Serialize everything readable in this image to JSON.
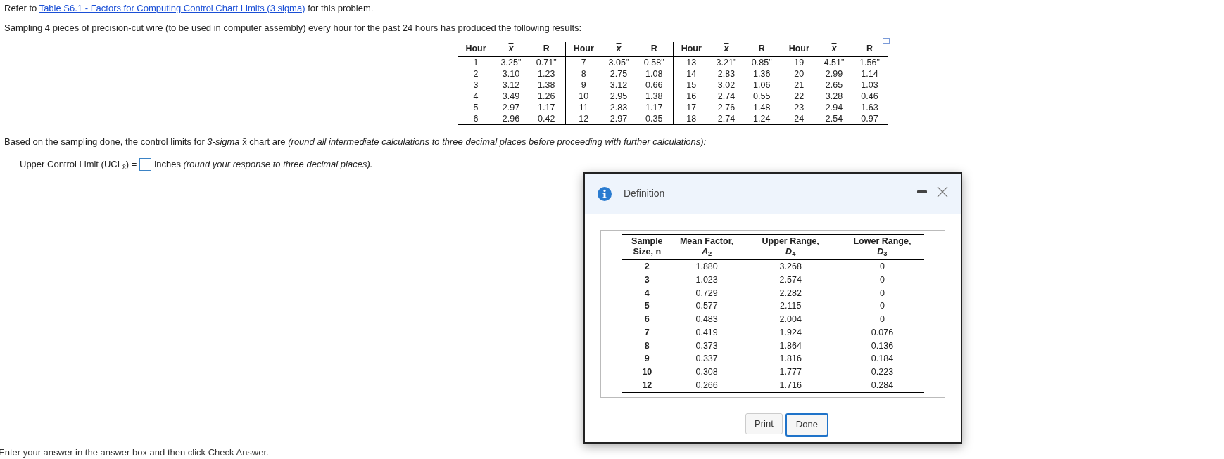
{
  "reference": {
    "prefix": "Refer to",
    "link": "Table S6.1 - Factors for Computing Control Chart Limits (3 sigma)",
    "suffix": "for this problem."
  },
  "intro": "Sampling 4 pieces of precision-cut wire (to be used in computer assembly) every hour for the past 24 hours has produced the following results:",
  "data_table": {
    "columns": [
      "Hour",
      "x",
      "R",
      "Hour",
      "x",
      "R",
      "Hour",
      "x",
      "R",
      "Hour",
      "x",
      "R"
    ],
    "rows": [
      [
        "1",
        "3.25\"",
        "0.71\"",
        "7",
        "3.05\"",
        "0.58\"",
        "13",
        "3.21\"",
        "0.85\"",
        "19",
        "4.51\"",
        "1.56\""
      ],
      [
        "2",
        "3.10",
        "1.23",
        "8",
        "2.75",
        "1.08",
        "14",
        "2.83",
        "1.36",
        "20",
        "2.99",
        "1.14"
      ],
      [
        "3",
        "3.12",
        "1.38",
        "9",
        "3.12",
        "0.66",
        "15",
        "3.02",
        "1.06",
        "21",
        "2.65",
        "1.03"
      ],
      [
        "4",
        "3.49",
        "1.26",
        "10",
        "2.95",
        "1.38",
        "16",
        "2.74",
        "0.55",
        "22",
        "3.28",
        "0.46"
      ],
      [
        "5",
        "2.97",
        "1.17",
        "11",
        "2.83",
        "1.17",
        "17",
        "2.76",
        "1.48",
        "23",
        "2.94",
        "1.63"
      ],
      [
        "6",
        "2.96",
        "0.42",
        "12",
        "2.97",
        "0.35",
        "18",
        "2.74",
        "1.24",
        "24",
        "2.54",
        "0.97"
      ]
    ]
  },
  "question": "Based on the sampling done, the control limits for *3-sigma* x̄ chart are *(round all intermediate calculations to three decimal places before proceeding with further calculations):*",
  "answer": {
    "label": "Upper Control Limit (UCL$_{x̄}$) =",
    "suffix": "inches *(round your response to three decimal places).*"
  },
  "footer": "Enter your answer in the answer box and then click Check Answer.",
  "dialog": {
    "title": "Definition",
    "columns": [
      {
        "line1": "Sample",
        "line2": "Size, n"
      },
      {
        "line1": "Mean Factor,",
        "line2": "*A*$_{2}$"
      },
      {
        "line1": "Upper Range,",
        "line2": "*D*$_{4}$"
      },
      {
        "line1": "Lower Range,",
        "line2": "*D*$_{3}$"
      }
    ],
    "rows": [
      [
        "2",
        "1.880",
        "3.268",
        "0"
      ],
      [
        "3",
        "1.023",
        "2.574",
        "0"
      ],
      [
        "4",
        "0.729",
        "2.282",
        "0"
      ],
      [
        "5",
        "0.577",
        "2.115",
        "0"
      ],
      [
        "6",
        "0.483",
        "2.004",
        "0"
      ],
      [
        "7",
        "0.419",
        "1.924",
        "0.076"
      ],
      [
        "8",
        "0.373",
        "1.864",
        "0.136"
      ],
      [
        "9",
        "0.337",
        "1.816",
        "0.184"
      ],
      [
        "10",
        "0.308",
        "1.777",
        "0.223"
      ],
      [
        "12",
        "0.266",
        "1.716",
        "0.284"
      ]
    ],
    "buttons": [
      {
        "label": "Print",
        "focused": false
      },
      {
        "label": "Done",
        "focused": true
      }
    ]
  }
}
